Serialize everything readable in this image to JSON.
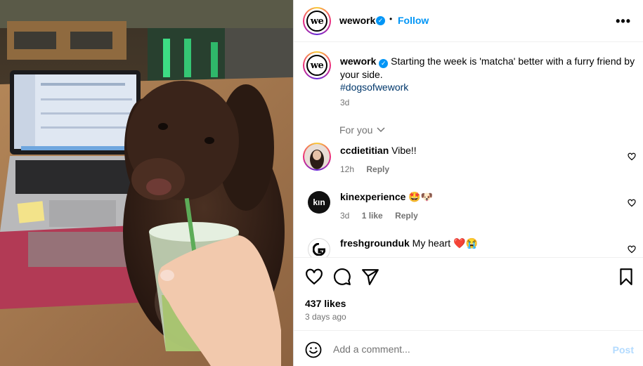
{
  "header": {
    "username": "wework",
    "follow_label": "Follow",
    "separator": "•",
    "more_label": "•••",
    "avatar_text": "we"
  },
  "caption": {
    "username": "wework",
    "text": "Starting the week is 'matcha' better with a furry friend by your side.",
    "hashtag": "#dogsofwework",
    "age": "3d",
    "avatar_text": "we"
  },
  "sort": {
    "label": "For you",
    "icon": "chevron-down-icon"
  },
  "comments": [
    {
      "username": "ccdietitian",
      "text": "Vibe!!",
      "age": "12h",
      "likes": "",
      "reply": "Reply"
    },
    {
      "username": "kinexperience",
      "text": "🤩🐶",
      "age": "3d",
      "likes": "1 like",
      "reply": "Reply",
      "avatar_text": "kın"
    },
    {
      "username": "freshgrounduk",
      "text": "My heart ❤️😭",
      "age": "",
      "likes": "",
      "reply": ""
    }
  ],
  "engagement": {
    "likes": "437 likes",
    "posted": "3 days ago"
  },
  "composer": {
    "placeholder": "Add a comment...",
    "post_label": "Post"
  },
  "colors": {
    "accent": "#0095f6",
    "hashtag": "#00376b",
    "muted": "#737373",
    "post_disabled": "#b3dbff"
  }
}
